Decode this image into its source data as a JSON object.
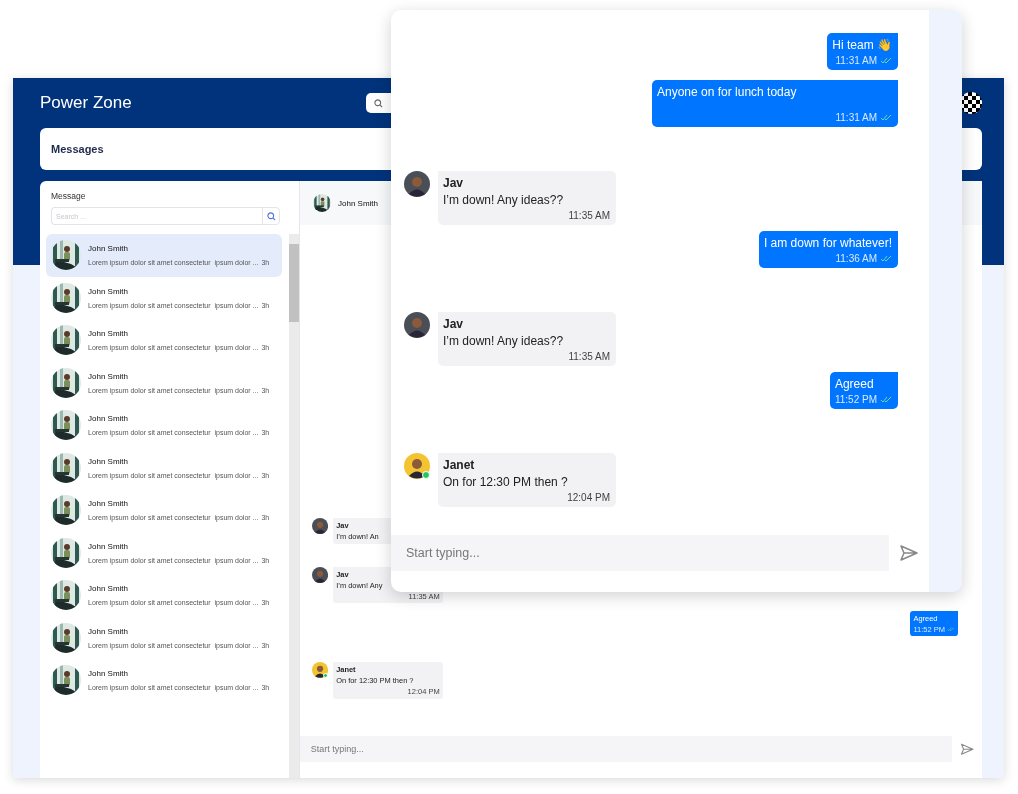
{
  "app": {
    "title": "Power Zone"
  },
  "page": {
    "title": "Messages"
  },
  "inbox": {
    "title": "Message",
    "search": {
      "placeholder": "Search ..."
    },
    "conversations": [
      {
        "name": "John Smith",
        "preview": "Lorem ipsum dolor sit amet consectetur  ipsum dolor ...",
        "time": "3h",
        "selected": true
      },
      {
        "name": "John Smith",
        "preview": "Lorem ipsum dolor sit amet consectetur  ipsum dolor ...",
        "time": "3h",
        "selected": false
      },
      {
        "name": "John Smith",
        "preview": "Lorem ipsum dolor sit amet consectetur  ipsum dolor ...",
        "time": "3h",
        "selected": false
      },
      {
        "name": "John Smith",
        "preview": "Lorem ipsum dolor sit amet consectetur  ipsum dolor ...",
        "time": "3h",
        "selected": false
      },
      {
        "name": "John Smith",
        "preview": "Lorem ipsum dolor sit amet consectetur  ipsum dolor ...",
        "time": "3h",
        "selected": false
      },
      {
        "name": "John Smith",
        "preview": "Lorem ipsum dolor sit amet consectetur  ipsum dolor ...",
        "time": "3h",
        "selected": false
      },
      {
        "name": "John Smith",
        "preview": "Lorem ipsum dolor sit amet consectetur  ipsum dolor ...",
        "time": "3h",
        "selected": false
      },
      {
        "name": "John Smith",
        "preview": "Lorem ipsum dolor sit amet consectetur  ipsum dolor ...",
        "time": "3h",
        "selected": false
      },
      {
        "name": "John Smith",
        "preview": "Lorem ipsum dolor sit amet consectetur  ipsum dolor ...",
        "time": "3h",
        "selected": false
      },
      {
        "name": "John Smith",
        "preview": "Lorem ipsum dolor sit amet consectetur  ipsum dolor ...",
        "time": "3h",
        "selected": false
      },
      {
        "name": "John Smith",
        "preview": "Lorem ipsum dolor sit amet consectetur  ipsum dolor ...",
        "time": "3h",
        "selected": false
      }
    ]
  },
  "chat": {
    "contact": "John Smith",
    "messages": [
      {
        "kind": "incoming",
        "sender": "Jav",
        "text": "I’m down! An",
        "color": "#4a4f57",
        "online": false
      },
      {
        "kind": "incoming",
        "sender": "Jav",
        "text": "I’m down! Any",
        "time": "11:35 AM",
        "color": "#4a4f57",
        "online": false
      },
      {
        "kind": "outgoing",
        "text": "Agreed",
        "time": "11:52 PM",
        "read": true
      },
      {
        "kind": "incoming",
        "sender": "Janet",
        "text": "On for 12:30 PM then ?",
        "time": "12:04 PM",
        "color": "#f4c430",
        "online": true
      }
    ],
    "composer": {
      "placeholder": "Start typing..."
    }
  },
  "popup": {
    "messages": [
      {
        "kind": "outgoing",
        "text": "Hi team 👋",
        "time": "11:31 AM",
        "read": true
      },
      {
        "kind": "outgoing",
        "text": "Anyone on for lunch today",
        "time": "11:31 AM",
        "read": true,
        "tall": true
      },
      {
        "kind": "incoming",
        "sender": "Jav",
        "text": "I’m down! Any ideas??",
        "time": "11:35 AM",
        "color": "#4a4f57",
        "online": false
      },
      {
        "kind": "outgoing",
        "text": "I am down for whatever!",
        "time": "11:36 AM",
        "read": true
      },
      {
        "kind": "incoming",
        "sender": "Jav",
        "text": "I’m down! Any ideas??",
        "time": "11:35 AM",
        "color": "#4a4f57",
        "online": false
      },
      {
        "kind": "outgoing",
        "text": "Agreed",
        "time": "11:52 PM",
        "read": true
      },
      {
        "kind": "incoming",
        "sender": "Janet",
        "text": "On for 12:30 PM then ?",
        "time": "12:04 PM",
        "color": "#f4c430",
        "online": true
      }
    ],
    "composer": {
      "placeholder": "Start typing..."
    }
  }
}
